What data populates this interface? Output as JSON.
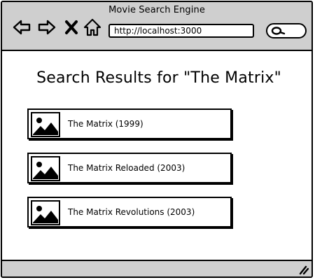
{
  "window": {
    "title": "Movie Search Engine",
    "url": "http://localhost:3000"
  },
  "toolbar": {
    "back_icon": "arrow-left-icon",
    "forward_icon": "arrow-right-icon",
    "stop_icon": "close-icon",
    "home_icon": "home-icon",
    "search_icon": "search-icon"
  },
  "page": {
    "heading": "Search Results for \"The Matrix\""
  },
  "results": [
    {
      "title": "The Matrix (1999)",
      "icon": "image-icon"
    },
    {
      "title": "The Matrix Reloaded (2003)",
      "icon": "image-icon"
    },
    {
      "title": "The Matrix Revolutions (2003)",
      "icon": "image-icon"
    }
  ],
  "colors": {
    "chrome": "#cfcfcf",
    "ink": "#000000",
    "background": "#ffffff"
  }
}
